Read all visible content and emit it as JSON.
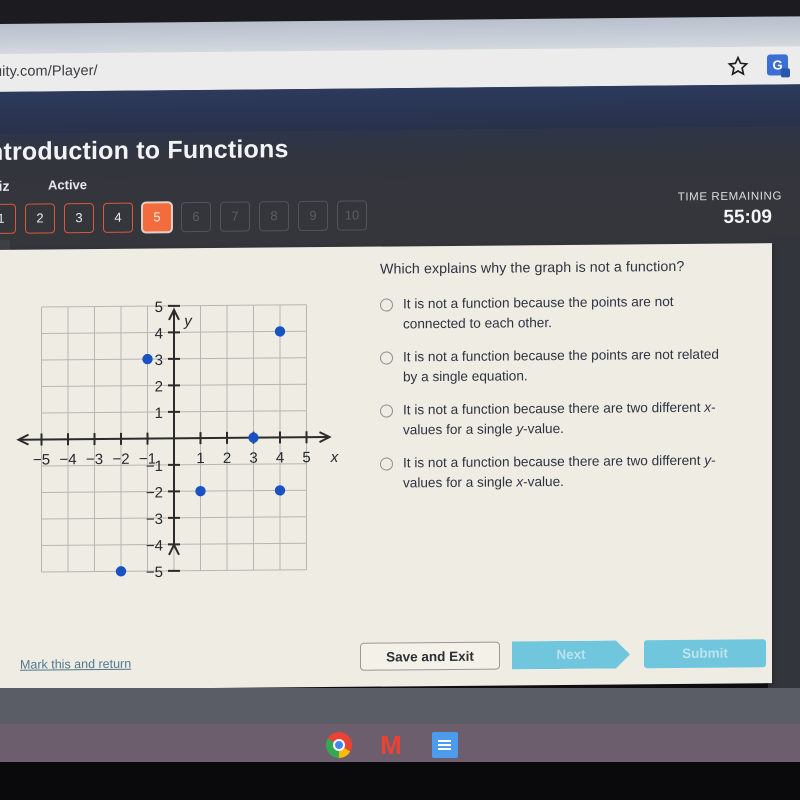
{
  "browser": {
    "url": "uity.com/Player/",
    "bookmark_icon": "star-icon",
    "extension_icon": "translate-extension-icon"
  },
  "header": {
    "title": "ntroduction to Functions",
    "kind": "uiz",
    "state": "Active",
    "time_label": "TIME REMAINING",
    "time_value": "55:09",
    "question_numbers": [
      {
        "label": "1",
        "state": "answered"
      },
      {
        "label": "2",
        "state": "answered"
      },
      {
        "label": "3",
        "state": "answered"
      },
      {
        "label": "4",
        "state": "answered"
      },
      {
        "label": "5",
        "state": "current"
      },
      {
        "label": "6",
        "state": "locked"
      },
      {
        "label": "7",
        "state": "locked"
      },
      {
        "label": "8",
        "state": "locked"
      },
      {
        "label": "9",
        "state": "locked"
      },
      {
        "label": "10",
        "state": "locked"
      }
    ],
    "accent_color": "#f26c3d",
    "background_color": "#35363c"
  },
  "question": {
    "prompt": "Which explains why the graph is not a function?",
    "options": [
      {
        "id": "a",
        "line1": "It is not a function because the points are not",
        "line2": "connected to each other.",
        "selected": false
      },
      {
        "id": "b",
        "line1": "It is not a function because the points are not related",
        "line2": "by a single equation.",
        "selected": false
      },
      {
        "id": "c",
        "line1": "It is not a function because there are two different x-",
        "line2": "values for a single y-value.",
        "selected": false
      },
      {
        "id": "d",
        "line1": "It is not a function because there are two different y-",
        "line2": "values for a single x-value.",
        "selected": false
      }
    ]
  },
  "footer": {
    "mark_link": "Mark this and return",
    "save_label": "Save and Exit",
    "next_label": "Next",
    "submit_label": "Submit",
    "button_color": "#6fc6dd"
  },
  "taskbar": {
    "icons": [
      "chrome-icon",
      "gmail-icon",
      "google-docs-icon"
    ]
  },
  "chart_data": {
    "type": "scatter",
    "title": "",
    "xlabel": "x",
    "ylabel": "y",
    "xlim": [
      -5,
      5
    ],
    "ylim": [
      -5,
      5
    ],
    "grid": true,
    "legend": "none",
    "point_color": "#1a52c4",
    "xticks": [
      -5,
      -4,
      -3,
      -2,
      -1,
      1,
      2,
      3,
      4,
      5
    ],
    "yticks": [
      -5,
      -4,
      -3,
      -2,
      -1,
      1,
      2,
      3,
      4,
      5
    ],
    "xtick_labels": [
      "-5",
      "-4",
      "-3",
      "-2",
      "-1",
      "1",
      "2",
      "3",
      "4",
      "5"
    ],
    "ytick_labels": [
      "-5",
      "-4",
      "-3",
      "-2",
      "-1",
      "1",
      "2",
      "3",
      "4",
      "5"
    ],
    "points": [
      {
        "x": -1,
        "y": 3
      },
      {
        "x": 4,
        "y": 4
      },
      {
        "x": 3,
        "y": 0
      },
      {
        "x": 1,
        "y": -2
      },
      {
        "x": 4,
        "y": -2
      },
      {
        "x": -2,
        "y": -5
      }
    ]
  }
}
